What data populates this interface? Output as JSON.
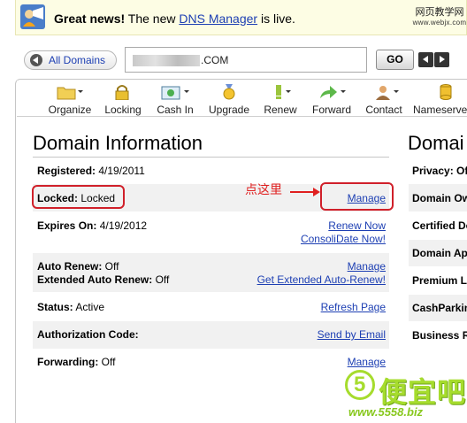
{
  "notice": {
    "headline": "Great news!",
    "text_before": " The new ",
    "link": "DNS Manager",
    "text_after": " is live."
  },
  "watermark_top": {
    "line1": "网页教学网",
    "line2": "www.webjx.com"
  },
  "domain_bar": {
    "all_domains_label": "All Domains",
    "domain_value_visible": ".COM",
    "go_label": "GO"
  },
  "toolbar": {
    "items": [
      {
        "label": "Organize",
        "icon": "folder-icon"
      },
      {
        "label": "Locking",
        "icon": "lock-icon"
      },
      {
        "label": "Cash In",
        "icon": "cash-in-icon"
      },
      {
        "label": "Upgrade",
        "icon": "upgrade-medal-icon"
      },
      {
        "label": "Renew",
        "icon": "renew-icon"
      },
      {
        "label": "Forward",
        "icon": "forward-arrow-icon"
      },
      {
        "label": "Contact",
        "icon": "contact-person-icon"
      },
      {
        "label": "Nameserve",
        "icon": "nameserver-stack-icon"
      }
    ]
  },
  "domain_info": {
    "title": "Domain Information",
    "registered_label": "Registered:",
    "registered_value": " 4/19/2011",
    "locked_label": "Locked:",
    "locked_value": " Locked",
    "locked_link": "Manage",
    "expires_label": "Expires On:",
    "expires_value": " 4/19/2012",
    "renew_link": "Renew Now",
    "consolidate_link": "ConsoliDate Now!",
    "auto_renew_label": "Auto Renew:",
    "auto_renew_value": " Off",
    "auto_renew_link": "Manage",
    "ext_auto_renew_label": "Extended Auto Renew:",
    "ext_auto_renew_value": " Off",
    "ext_auto_renew_link": "Get Extended Auto-Renew!",
    "status_label": "Status:",
    "status_value": " Active",
    "status_link": "Refresh Page",
    "auth_label": "Authorization Code:",
    "auth_link": "Send by Email",
    "forwarding_label": "Forwarding:",
    "forwarding_value": " Off",
    "forwarding_link": "Manage"
  },
  "right_column": {
    "title": "Domai",
    "rows": [
      "Privacy: Of",
      "Domain Ow",
      "Certified Do",
      "Domain Ap",
      "Premium L",
      "CashParkin",
      "Business R"
    ]
  },
  "annotation": {
    "text": "点这里"
  },
  "watermark_bottom": {
    "big": "便宜吧",
    "url": "www.5558.biz"
  },
  "colors": {
    "link": "#1d3fb3",
    "annotation_red": "#d0202a",
    "notice_bg": "#fdfde4"
  }
}
